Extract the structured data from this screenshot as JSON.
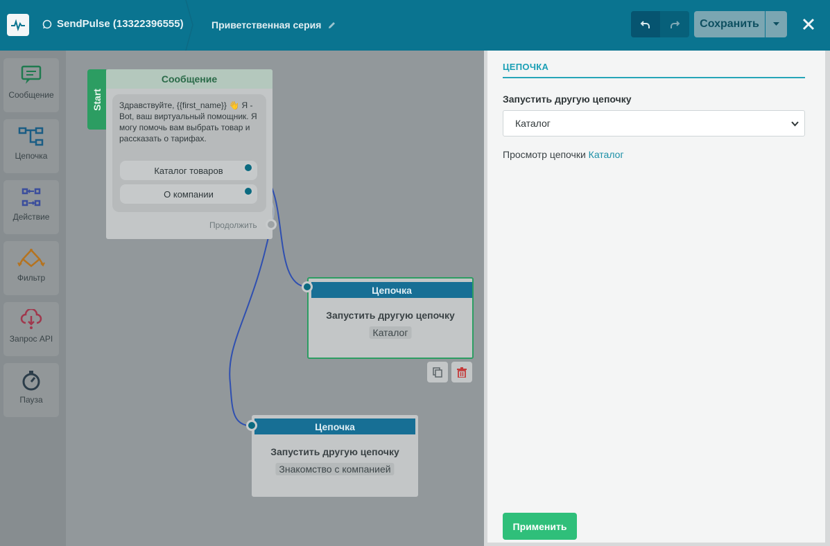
{
  "header": {
    "bot_name": "SendPulse (13322396555)",
    "flow_name": "Приветственная серия",
    "save_label": "Сохранить"
  },
  "toolbox": {
    "items": [
      {
        "label": "Сообщение",
        "icon": "message-icon"
      },
      {
        "label": "Цепочка",
        "icon": "chain-icon"
      },
      {
        "label": "Действие",
        "icon": "action-icon"
      },
      {
        "label": "Фильтр",
        "icon": "filter-icon"
      },
      {
        "label": "Запрос API",
        "icon": "api-icon"
      },
      {
        "label": "Пауза",
        "icon": "timer-icon"
      }
    ]
  },
  "canvas": {
    "start_label": "Start",
    "message_node": {
      "header": "Сообщение",
      "text": "Здравствуйте,  {{first_name}} 👋 Я - Bot, ваш виртуальный помощник. Я могу помочь вам выбрать товар и рассказать о тарифах.",
      "buttons": [
        "Каталог товаров",
        "О компании"
      ],
      "continue_label": "Продолжить"
    },
    "chain_nodes": [
      {
        "header": "Цепочка",
        "title": "Запустить другую цепочку",
        "target": "Каталог"
      },
      {
        "header": "Цепочка",
        "title": "Запустить другую цепочку",
        "target": "Знакомство с компанией"
      }
    ]
  },
  "panel": {
    "tab": "ЦЕПОЧКА",
    "field_label": "Запустить другую цепочку",
    "selected_chain": "Каталог",
    "view_prefix": "Просмотр цепочки",
    "view_link": "Каталог",
    "apply_label": "Применить"
  },
  "colors": {
    "header_bg": "#0a7490",
    "chain_header": "#176f95",
    "start_green": "#2c9d62",
    "accent_teal": "#1a9fb5",
    "apply_green": "#2fbf7a"
  }
}
